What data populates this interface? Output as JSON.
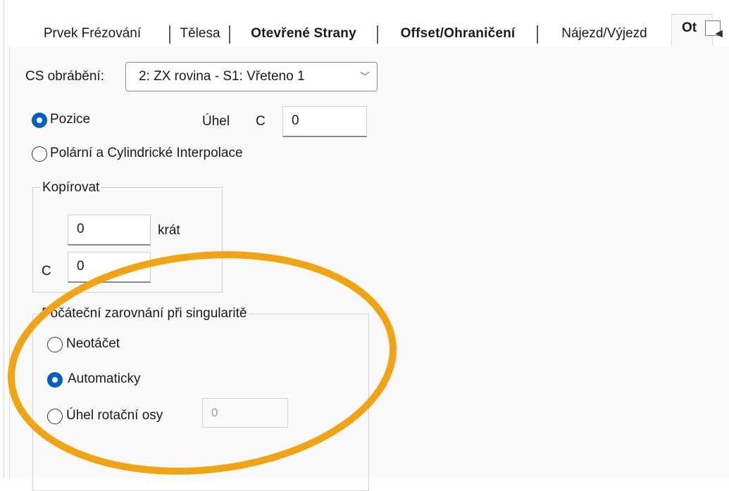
{
  "tabs": [
    {
      "label": "Prvek Frézování",
      "bold": false
    },
    {
      "label": "Tělesa",
      "bold": false
    },
    {
      "label": "Otevřené Strany",
      "bold": true
    },
    {
      "label": "Offset/Ohraničení",
      "bold": true
    },
    {
      "label": "Nájezd/Výjezd",
      "bold": false
    }
  ],
  "active_tab": {
    "label": "Ot"
  },
  "scroll_left_glyph": "◂",
  "cs": {
    "label": "CS obrábění:",
    "value": "2: ZX rovina - S1: Vřeteno 1",
    "chevron": "﹀"
  },
  "position_mode": {
    "option_position": "Pozice",
    "option_polar": "Polární a Cylindrické Interpolace",
    "selected": "Pozice"
  },
  "angle": {
    "label": "Úhel",
    "axis": "C",
    "value": "0"
  },
  "copy": {
    "title": "Kopírovat",
    "count_value": "0",
    "count_unit": "krát",
    "c_label": "C",
    "c_value": "0"
  },
  "singularity": {
    "title": "Počáteční zarovnání při singularitě",
    "option_no_rotate": "Neotáčet",
    "option_auto": "Automaticky",
    "option_angle": "Úhel rotační osy",
    "angle_value": "0",
    "selected": "Automaticky"
  },
  "colors": {
    "highlight_ellipse": "#f0a313",
    "radio_selected": "#0060c0"
  }
}
